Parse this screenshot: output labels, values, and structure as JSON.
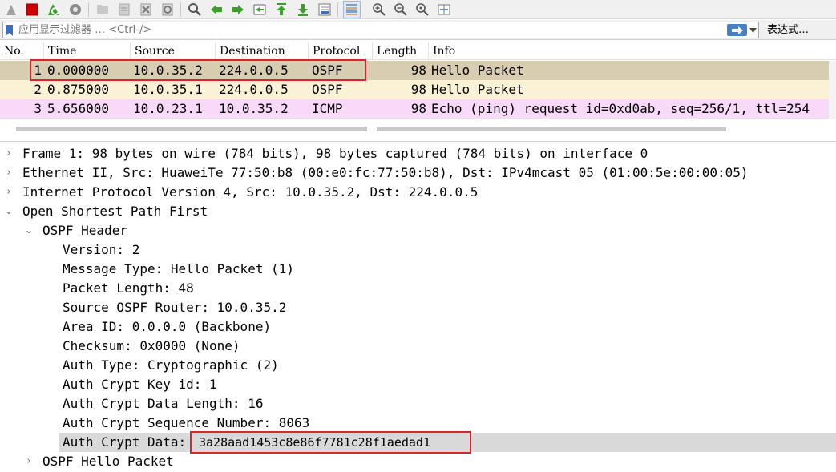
{
  "toolbar": {
    "icons": [
      "shark-fin-icon",
      "stop-capture-icon",
      "restart-capture-icon",
      "capture-options-icon",
      "open-file-icon",
      "save-file-icon",
      "close-file-icon",
      "reload-icon",
      "find-packet-icon",
      "go-back-icon",
      "go-forward-icon",
      "go-to-packet-icon",
      "go-first-icon",
      "go-last-icon",
      "autoscroll-icon",
      "colorize-icon",
      "zoom-in-icon",
      "zoom-out-icon",
      "normal-size-icon",
      "resize-columns-icon"
    ]
  },
  "filter": {
    "placeholder": "应用显示过滤器 … <Ctrl-/>",
    "expression_label": "表达式…"
  },
  "packet_list": {
    "columns": [
      "No.",
      "Time",
      "Source",
      "Destination",
      "Protocol",
      "Length",
      "Info"
    ],
    "rows": [
      {
        "no": "1",
        "time": "0.000000",
        "source": "10.0.35.2",
        "destination": "224.0.0.5",
        "protocol": "OSPF",
        "length": "98",
        "info": "Hello Packet"
      },
      {
        "no": "2",
        "time": "0.875000",
        "source": "10.0.35.1",
        "destination": "224.0.0.5",
        "protocol": "OSPF",
        "length": "98",
        "info": "Hello Packet"
      },
      {
        "no": "3",
        "time": "5.656000",
        "source": "10.0.23.1",
        "destination": "10.0.35.2",
        "protocol": "ICMP",
        "length": "98",
        "info": "Echo (ping) request  id=0xd0ab, seq=256/1, ttl=254"
      }
    ]
  },
  "details": {
    "frame": "Frame 1: 98 bytes on wire (784 bits), 98 bytes captured (784 bits) on interface 0",
    "ethernet": "Ethernet II, Src: HuaweiTe_77:50:b8 (00:e0:fc:77:50:b8), Dst: IPv4mcast_05 (01:00:5e:00:00:05)",
    "ip": "Internet Protocol Version 4, Src: 10.0.35.2, Dst: 224.0.0.5",
    "ospf": "Open Shortest Path First",
    "ospf_header": "OSPF Header",
    "fields": {
      "version": "Version: 2",
      "message_type": "Message Type: Hello Packet (1)",
      "packet_length": "Packet Length: 48",
      "source_router": "Source OSPF Router: 10.0.35.2",
      "area_id": "Area ID: 0.0.0.0 (Backbone)",
      "checksum": "Checksum: 0x0000 (None)",
      "auth_type": "Auth Type: Cryptographic (2)",
      "auth_key_id": "Auth Crypt Key id: 1",
      "auth_data_length": "Auth Crypt Data Length: 16",
      "auth_seq": "Auth Crypt Sequence Number: 8063",
      "auth_data_label": "Auth Crypt Data:",
      "auth_data_value": "3a28aad1453c8e86f7781c28f1aedad1"
    },
    "hello": "OSPF Hello Packet"
  },
  "colors": {
    "row_ospf_selected": "#d8ccb1",
    "row_ospf": "#fbf2d5",
    "row_icmp": "#f8daf8",
    "highlight_box": "#d9242c"
  }
}
